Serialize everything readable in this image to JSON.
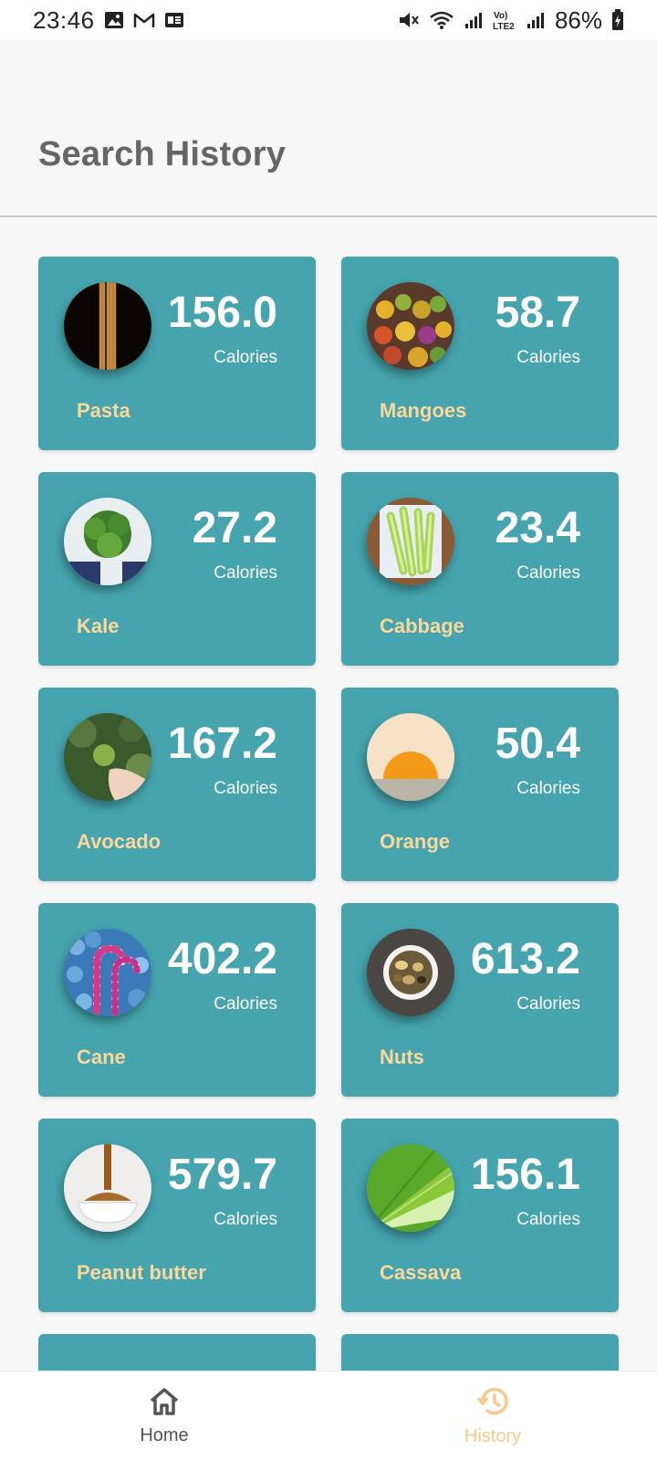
{
  "status_bar": {
    "time": "23:46",
    "battery": "86%",
    "left_icons": [
      "image-icon",
      "gmail-icon",
      "ge-icon"
    ],
    "right_icons": [
      "mute-icon",
      "wifi-icon",
      "signal-icon",
      "volte-lte2-icon",
      "signal-icon",
      "battery-charging-icon"
    ]
  },
  "header": {
    "title": "Search History"
  },
  "cards": [
    {
      "name": "Pasta",
      "calories": "156.0",
      "unit": "Calories",
      "image": "pasta"
    },
    {
      "name": "Mangoes",
      "calories": "58.7",
      "unit": "Calories",
      "image": "mangoes"
    },
    {
      "name": "Kale",
      "calories": "27.2",
      "unit": "Calories",
      "image": "kale"
    },
    {
      "name": "Cabbage",
      "calories": "23.4",
      "unit": "Calories",
      "image": "cabbage"
    },
    {
      "name": "Avocado",
      "calories": "167.2",
      "unit": "Calories",
      "image": "avocado"
    },
    {
      "name": "Orange",
      "calories": "50.4",
      "unit": "Calories",
      "image": "orange"
    },
    {
      "name": "Cane",
      "calories": "402.2",
      "unit": "Calories",
      "image": "cane"
    },
    {
      "name": "Nuts",
      "calories": "613.2",
      "unit": "Calories",
      "image": "nuts"
    },
    {
      "name": "Peanut butter",
      "calories": "579.7",
      "unit": "Calories",
      "image": "peanut-butter"
    },
    {
      "name": "Cassava",
      "calories": "156.1",
      "unit": "Calories",
      "image": "cassava"
    }
  ],
  "nav": {
    "home_label": "Home",
    "history_label": "History",
    "active": "History",
    "active_color": "#f7c98b",
    "inactive_color": "#555555"
  },
  "colors": {
    "card": "#45a4ae",
    "food_name": "#fcd79a",
    "title": "#666666"
  }
}
